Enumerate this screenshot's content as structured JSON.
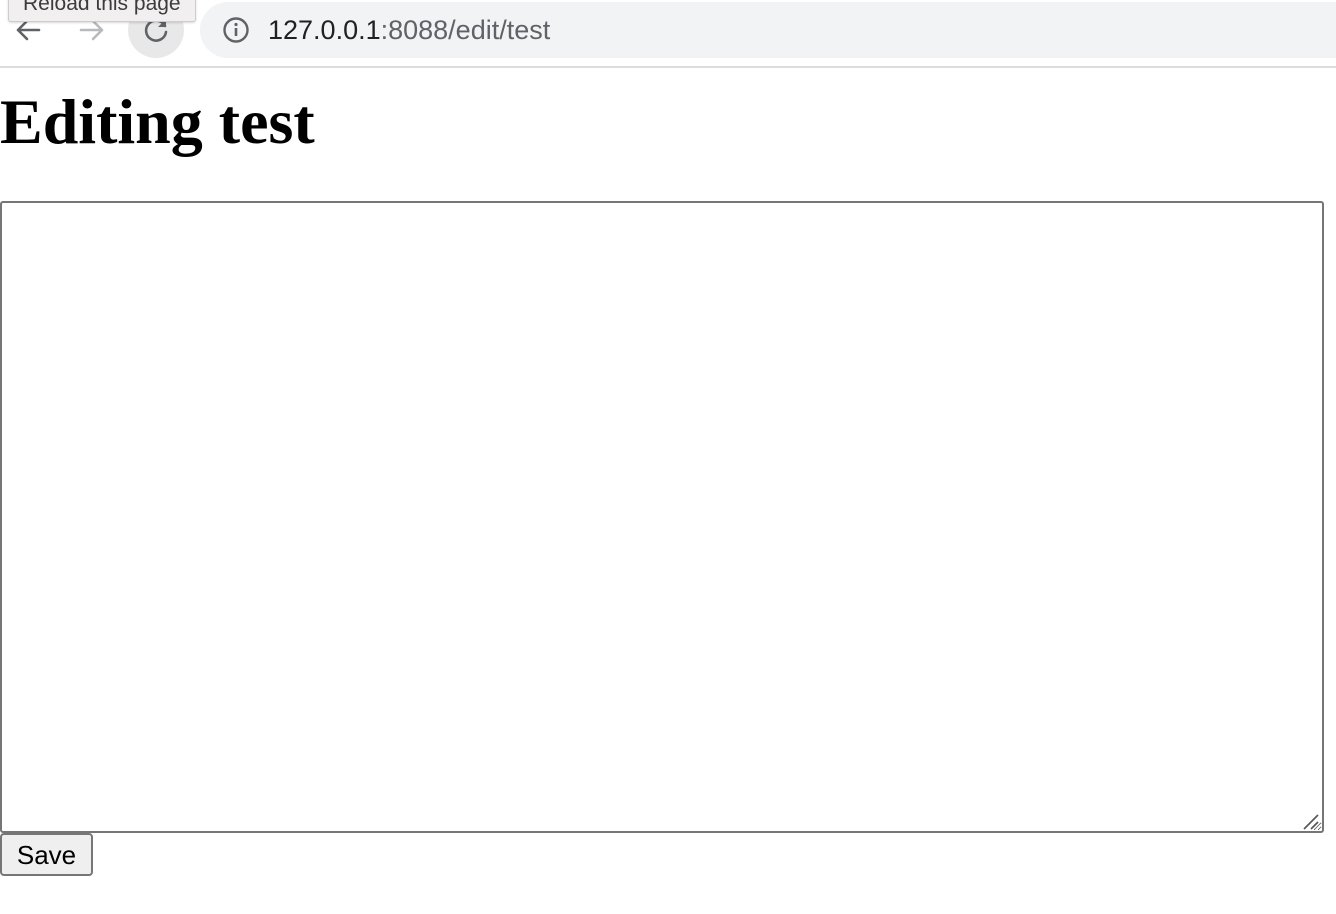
{
  "browser": {
    "tooltip": "Reload this page",
    "url_host": "127.0.0.1",
    "url_rest": ":8088/edit/test",
    "icons": {
      "back": "back-arrow-icon",
      "forward": "forward-arrow-icon",
      "reload": "reload-icon",
      "info": "info-icon"
    }
  },
  "page": {
    "title": "Editing test",
    "editor_value": "",
    "save_label": "Save"
  }
}
